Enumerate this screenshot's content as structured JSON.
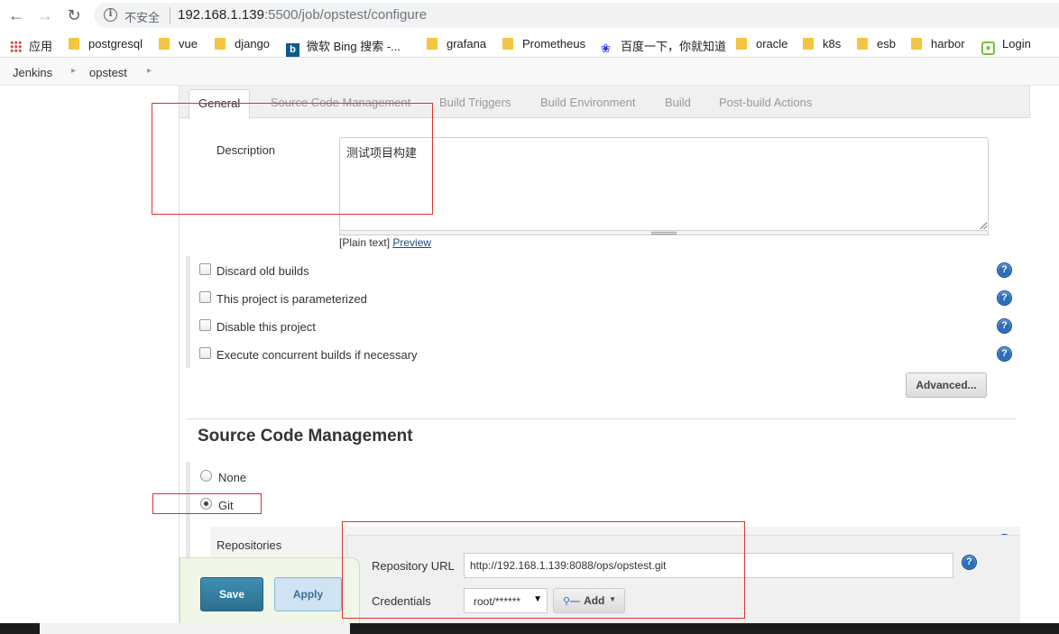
{
  "browser": {
    "insecure_label": "不安全",
    "url_host": "192.168.1.139",
    "url_path": ":5500/job/opstest/configure"
  },
  "bookmarks": [
    {
      "label": "应用",
      "icon": "apps-icon"
    },
    {
      "label": "postgresql",
      "icon": "folder-icon"
    },
    {
      "label": "vue",
      "icon": "folder-icon"
    },
    {
      "label": "django",
      "icon": "folder-icon"
    },
    {
      "label": "微软 Bing 搜索 -...",
      "icon": "bing-icon"
    },
    {
      "label": "grafana",
      "icon": "folder-icon"
    },
    {
      "label": "Prometheus",
      "icon": "folder-icon"
    },
    {
      "label": "百度一下，你就知道",
      "icon": "baidu-icon"
    },
    {
      "label": "oracle",
      "icon": "folder-icon"
    },
    {
      "label": "k8s",
      "icon": "folder-icon"
    },
    {
      "label": "esb",
      "icon": "folder-icon"
    },
    {
      "label": "harbor",
      "icon": "folder-icon"
    },
    {
      "label": "Login",
      "icon": "login-icon"
    }
  ],
  "breadcrumb": [
    "Jenkins",
    "opstest"
  ],
  "tabs": [
    "General",
    "Source Code Management",
    "Build Triggers",
    "Build Environment",
    "Build",
    "Post-build Actions"
  ],
  "general": {
    "description_label": "Description",
    "description_value": "测试项目构建",
    "plain_text": "[Plain text]",
    "preview_link": "Preview",
    "options": [
      {
        "label": "Discard old builds",
        "checked": false
      },
      {
        "label": "This project is parameterized",
        "checked": false
      },
      {
        "label": "Disable this project",
        "checked": false
      },
      {
        "label": "Execute concurrent builds if necessary",
        "checked": false
      }
    ],
    "advanced_button": "Advanced..."
  },
  "scm": {
    "title": "Source Code Management",
    "options": [
      {
        "label": "None",
        "selected": false
      },
      {
        "label": "Git",
        "selected": true
      }
    ],
    "repositories_label": "Repositories",
    "repo_url_label": "Repository URL",
    "repo_url_value": "http://192.168.1.139:8088/ops/opstest.git",
    "credentials_label": "Credentials",
    "credentials_value": "root/******",
    "add_button": "Add"
  },
  "actions": {
    "save": "Save",
    "apply": "Apply"
  },
  "colors": {
    "annotation": "#e03030",
    "save_button": "#3f8fb3",
    "help_icon": "#2a6eba"
  }
}
